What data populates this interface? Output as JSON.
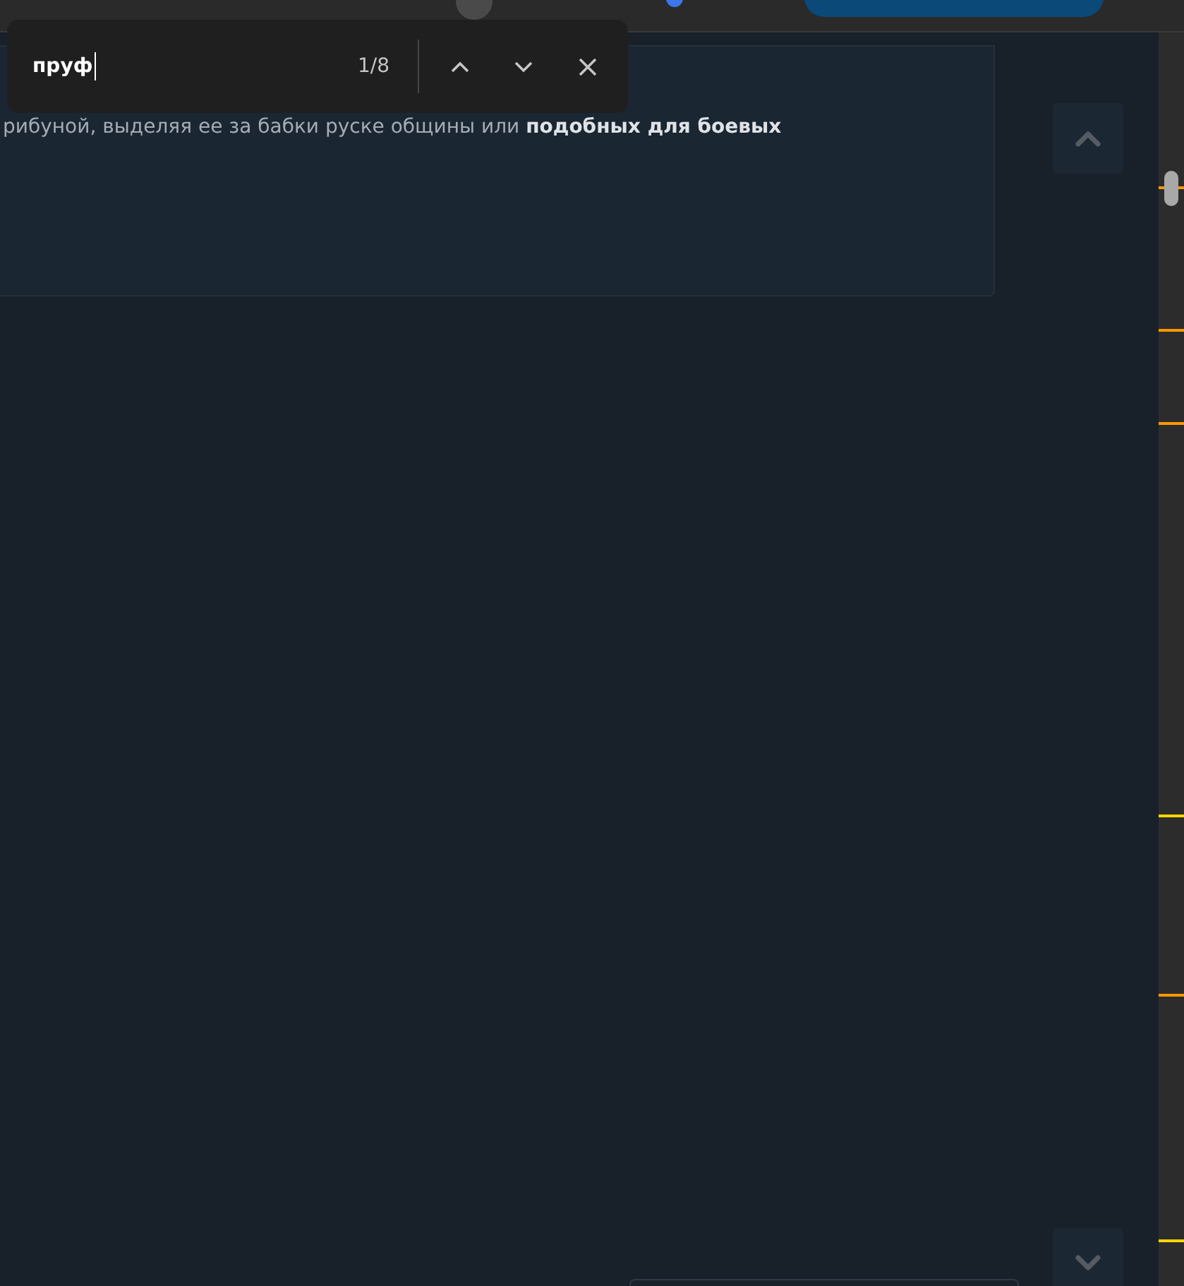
{
  "find_bar": {
    "query": "пруф",
    "count": "1/8"
  },
  "post": {
    "text": "рибуной, выделяя ее за бабки руске общины или **подобных для боевых**"
  },
  "scroll_markers": [
    {
      "color": "#ff9800"
    },
    {
      "color": "#ff9800"
    },
    {
      "color": "#ff9800"
    },
    {
      "color": "#ffd600"
    },
    {
      "color": "#ff9800"
    },
    {
      "color": "#ffd600"
    }
  ]
}
